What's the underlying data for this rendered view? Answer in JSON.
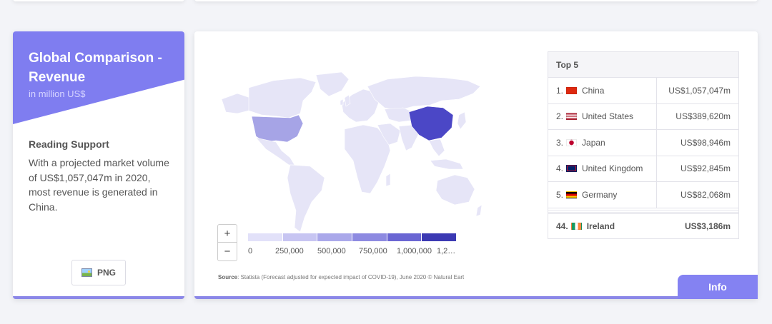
{
  "left_card": {
    "title": "Global Comparison - Revenue",
    "unit": "in million US$",
    "support_title": "Reading Support",
    "support_text": "With a projected market volume of US$1,057,047m in 2020, most revenue is generated in China.",
    "png_label": "PNG"
  },
  "map": {
    "zoom_in": "+",
    "zoom_out": "−",
    "legend_colors": [
      "#e2e1f9",
      "#c7c5f2",
      "#aaa8ea",
      "#8d8ae1",
      "#6a66d3",
      "#3b39b3"
    ],
    "legend_labels": [
      "0",
      "250,000",
      "500,000",
      "750,000",
      "1,000,000",
      "1,2…"
    ],
    "highlight_colors": {
      "china": "#4b47c6",
      "usa": "#a6a4e6",
      "default": "#e6e5f7"
    },
    "source_label": "Source",
    "source_text": ": Statista (Forecast adjusted for expected impact of COVID-19), June 2020 © Natural Eart"
  },
  "top5": {
    "heading": "Top 5",
    "rows": [
      {
        "rank": "1.",
        "country": "China",
        "value": "US$1,057,047m",
        "flag": "china-flag"
      },
      {
        "rank": "2.",
        "country": "United States",
        "value": "US$389,620m",
        "flag": "usa-flag"
      },
      {
        "rank": "3.",
        "country": "Japan",
        "value": "US$98,946m",
        "flag": "japan-flag"
      },
      {
        "rank": "4.",
        "country": "United Kingdom",
        "value": "US$92,845m",
        "flag": "uk-flag"
      },
      {
        "rank": "5.",
        "country": "Germany",
        "value": "US$82,068m",
        "flag": "germany-flag"
      }
    ],
    "own": {
      "rank": "44.",
      "country": "Ireland",
      "value": "US$3,186m",
      "flag": "ireland-flag"
    }
  },
  "info_label": "Info"
}
